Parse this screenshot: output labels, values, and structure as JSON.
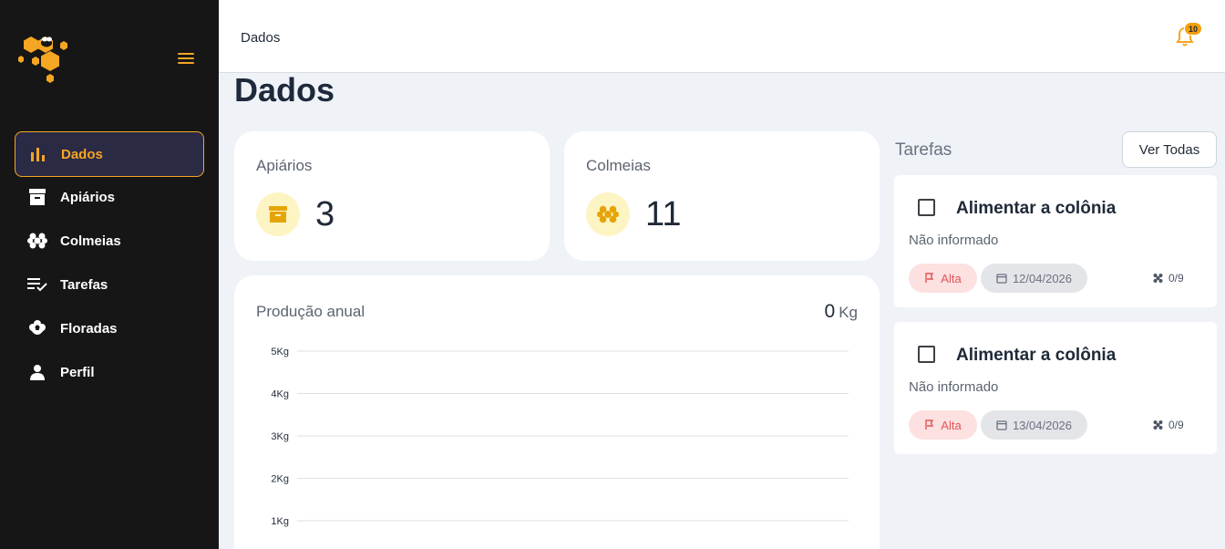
{
  "sidebar": {
    "items": [
      {
        "label": "Dados",
        "icon": "bar-chart-icon"
      },
      {
        "label": "Apiários",
        "icon": "archive-box-icon"
      },
      {
        "label": "Colmeias",
        "icon": "hive-icon"
      },
      {
        "label": "Tarefas",
        "icon": "checklist-icon"
      },
      {
        "label": "Floradas",
        "icon": "flower-icon"
      },
      {
        "label": "Perfil",
        "icon": "user-icon"
      }
    ]
  },
  "header": {
    "breadcrumb": "Dados",
    "notifications_count": "10"
  },
  "page": {
    "title": "Dados"
  },
  "stats": {
    "apiarios": {
      "label": "Apiários",
      "value": "3"
    },
    "colmeias": {
      "label": "Colmeias",
      "value": "11"
    }
  },
  "production": {
    "title": "Produção anual",
    "value": "0",
    "unit": "Kg"
  },
  "chart_data": {
    "type": "line",
    "title": "",
    "xlabel": "",
    "ylabel": "",
    "ylim": [
      0,
      5
    ],
    "y_ticks": [
      "5Kg",
      "4Kg",
      "3Kg",
      "2Kg",
      "1Kg"
    ],
    "grid": true,
    "series": []
  },
  "tasks": {
    "title": "Tarefas",
    "view_all_label": "Ver Todas",
    "items": [
      {
        "title": "Alimentar a colônia",
        "description": "Não informado",
        "priority": "Alta",
        "date": "12/04/2026",
        "count": "0/9"
      },
      {
        "title": "Alimentar a colônia",
        "description": "Não informado",
        "priority": "Alta",
        "date": "13/04/2026",
        "count": "0/9"
      }
    ]
  },
  "colors": {
    "accent": "#f5a623",
    "sidebar_bg": "#161616",
    "page_bg": "#eff3f8",
    "priority_high": "#e25555"
  }
}
